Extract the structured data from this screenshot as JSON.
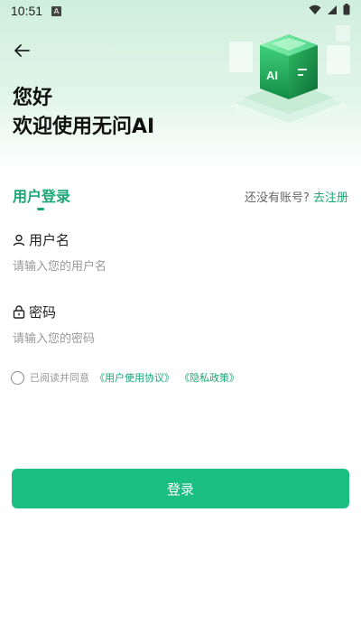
{
  "status_bar": {
    "time": "10:51",
    "notification_badge": "A"
  },
  "header": {
    "greeting": "您好",
    "welcome": "欢迎使用无问AI",
    "illustration_text": "AI"
  },
  "tabs": {
    "login": "用户登录",
    "register_prompt": "还没有账号?",
    "register_link": "去注册"
  },
  "username": {
    "label": "用户名",
    "placeholder": "请输入您的用户名",
    "value": ""
  },
  "password": {
    "label": "密码",
    "placeholder": "请输入您的密码",
    "value": ""
  },
  "agreement": {
    "prefix": "已阅读并同意",
    "user_agreement": "《用户使用协议》",
    "privacy_policy": "《隐私政策》",
    "checked": false
  },
  "login_button": "登录",
  "colors": {
    "accent": "#1aa876",
    "button": "#1cbf82",
    "hero_bg": "#d6f0e2"
  }
}
